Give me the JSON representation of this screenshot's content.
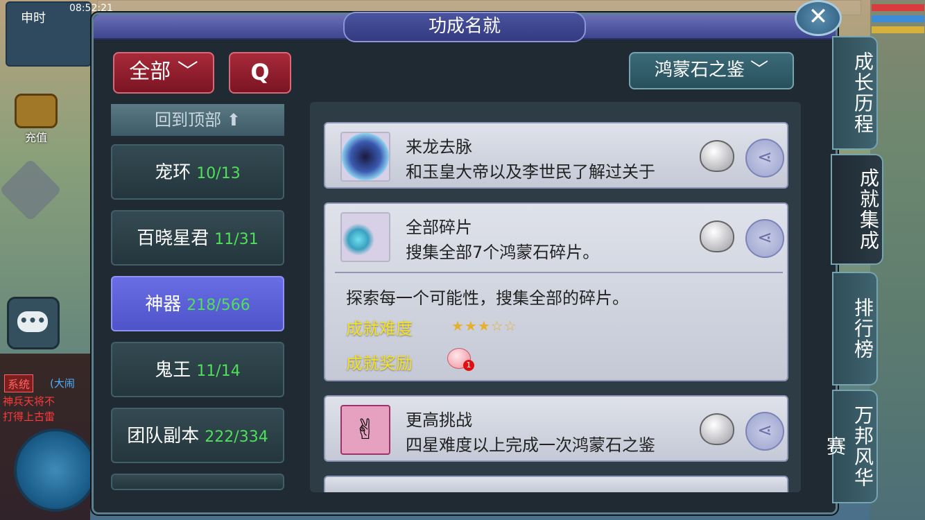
{
  "hud": {
    "time_label": "申时",
    "clock": "08:52:21",
    "recharge_label": "充值"
  },
  "panel": {
    "title": "功成名就"
  },
  "toolbar": {
    "filter_label": "全部",
    "category_label": "鸿蒙石之鉴"
  },
  "left_list": {
    "back_top_label": "回到顶部",
    "items": [
      {
        "name": "宠环",
        "count": "10/13"
      },
      {
        "name": "百晓星君",
        "count": "11/31"
      },
      {
        "name": "神器",
        "count": "218/566"
      },
      {
        "name": "鬼王",
        "count": "11/14"
      },
      {
        "name": "团队副本",
        "count": "222/334"
      }
    ]
  },
  "achievements": [
    {
      "name": "来龙去脉",
      "desc": "和玉皇大帝以及李世民了解过关于"
    },
    {
      "name": "全部碎片",
      "desc": "搜集全部7个鸿蒙石碎片。",
      "detail": "探索每一个可能性，搜集全部的碎片。",
      "difficulty_label": "成就难度",
      "difficulty_stars": 3,
      "difficulty_max": 5,
      "reward_label": "成就奖励",
      "reward_count": "1"
    },
    {
      "name": "更高挑战",
      "desc": "四星难度以上完成一次鸿蒙石之鉴"
    }
  ],
  "side_tabs": [
    "成长历程",
    "成就集成",
    "排行榜",
    "万邦风华赛"
  ],
  "chat": {
    "channel": "系统",
    "lines": [
      "(大闹",
      "神兵天将不",
      "打得上古雷"
    ]
  },
  "colors": {
    "accent_purple": "#5c61d8",
    "count_green": "#4fe05a",
    "label_yellow": "#f2e02a",
    "button_red": "#a82a3a"
  }
}
